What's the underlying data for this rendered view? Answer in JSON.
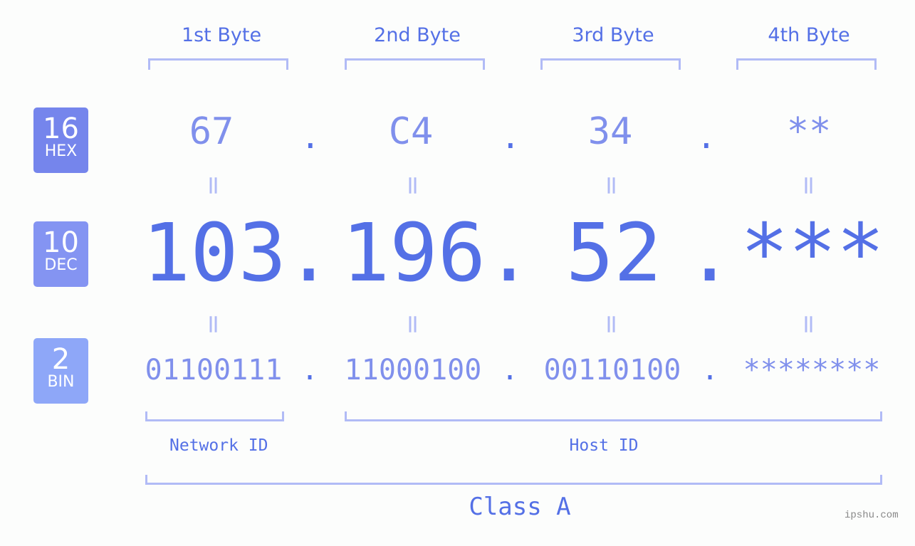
{
  "bytes": {
    "headers": [
      "1st Byte",
      "2nd Byte",
      "3rd Byte",
      "4th Byte"
    ]
  },
  "bases": [
    {
      "number": "16",
      "label": "HEX",
      "color": "#7585ec"
    },
    {
      "number": "10",
      "label": "DEC",
      "color": "#8494f2"
    },
    {
      "number": "2",
      "label": "BIN",
      "color": "#8ea7f8"
    }
  ],
  "hex": [
    "67",
    "C4",
    "34",
    "**"
  ],
  "dec": [
    "103",
    "196",
    "52",
    "***"
  ],
  "bin": [
    "01100111",
    "11000100",
    "00110100",
    "********"
  ],
  "separator": ".",
  "equals": "=",
  "segments": {
    "network": "Network ID",
    "host": "Host ID",
    "class": "Class A"
  },
  "watermark": "ipshu.com",
  "colors": {
    "primary": "#5470e6",
    "secondary": "#8090ec",
    "bracket": "#b1bbf6"
  }
}
